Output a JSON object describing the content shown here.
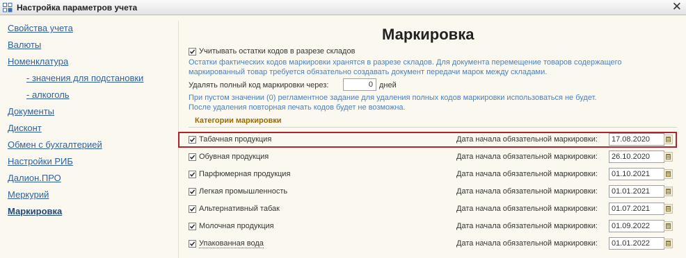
{
  "window": {
    "title": "Настройка параметров учета",
    "close_glyph": "✕"
  },
  "sidebar": {
    "items": [
      {
        "label": "Свойства учета"
      },
      {
        "label": "Валюты"
      },
      {
        "label": "Номенклатура"
      },
      {
        "label": "- значения для подстановки"
      },
      {
        "label": "- алкоголь"
      },
      {
        "label": "Документы"
      },
      {
        "label": "Дисконт"
      },
      {
        "label": "Обмен с бухгалтерией"
      },
      {
        "label": "Настройки РИБ"
      },
      {
        "label": "Далион.ПРО"
      },
      {
        "label": "Меркурий"
      },
      {
        "label": "Маркировка"
      }
    ],
    "active_index": 11
  },
  "main": {
    "heading": "Маркировка",
    "warehouse_option": {
      "label": "Учитывать остатки кодов в разрезе складов",
      "checked": true,
      "note_line1": "Остатки фактических кодов маркировки хранятся в разрезе складов. Для документа перемещение товаров содержащего",
      "note_line2": "маркированный товар требуется обязательно создавать документ передачи марок между складами."
    },
    "delete_code": {
      "label": "Удалять полный код маркировки через:",
      "value": "0",
      "unit": "дней",
      "note_line1": "При пустом значении (0) регламентное задание для удаления полных кодов маркировки использоваться не будет.",
      "note_line2": "После удаления повторная печать кодов будет не возможна."
    },
    "categories_title": "Категории маркировки",
    "date_label": "Дата начала обязательной маркировки:",
    "categories": [
      {
        "name": "Табачная продукция",
        "date": "17.08.2020",
        "checked": true
      },
      {
        "name": "Обувная продукция",
        "date": "26.10.2020",
        "checked": true
      },
      {
        "name": "Парфюмерная продукция",
        "date": "01.10.2021",
        "checked": true
      },
      {
        "name": "Легкая промышленность",
        "date": "01.01.2021",
        "checked": true
      },
      {
        "name": "Альтернативный табак",
        "date": "01.07.2021",
        "checked": true
      },
      {
        "name": "Молочная продукция",
        "date": "01.09.2022",
        "checked": true
      },
      {
        "name": "Упакованная вода",
        "date": "01.01.2022",
        "checked": true
      }
    ]
  },
  "colors": {
    "background": "#fbf9ef",
    "link": "#2f5f9e",
    "note_text": "#4a7fc1",
    "section_title": "#9a6a00",
    "highlight_border": "#b2222a"
  },
  "icons": {
    "app": "settings-grid-icon",
    "close": "close-icon",
    "checkbox": "checkmark-icon",
    "date_picker": "calendar-icon"
  }
}
